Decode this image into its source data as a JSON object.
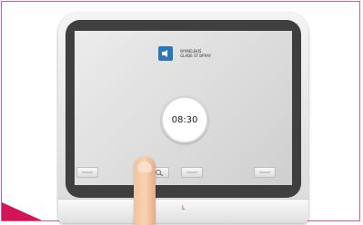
{
  "notification": {
    "line1": "WYMELEKIŚ",
    "line2": "GLADE ST BPRAY"
  },
  "timer": {
    "value": "08:30"
  },
  "device": {
    "brand": "L"
  },
  "colors": {
    "frame_border": "#e05c86",
    "corner_mark": "#d3145a",
    "notification_icon": "#2b77b8"
  },
  "icons": {
    "notification": "speaker-icon",
    "soft_key_a": "flat-key-icon",
    "soft_key_b": "magnify-icon",
    "soft_key_c": "flat-key-icon",
    "soft_key_d": "flat-key-icon"
  }
}
